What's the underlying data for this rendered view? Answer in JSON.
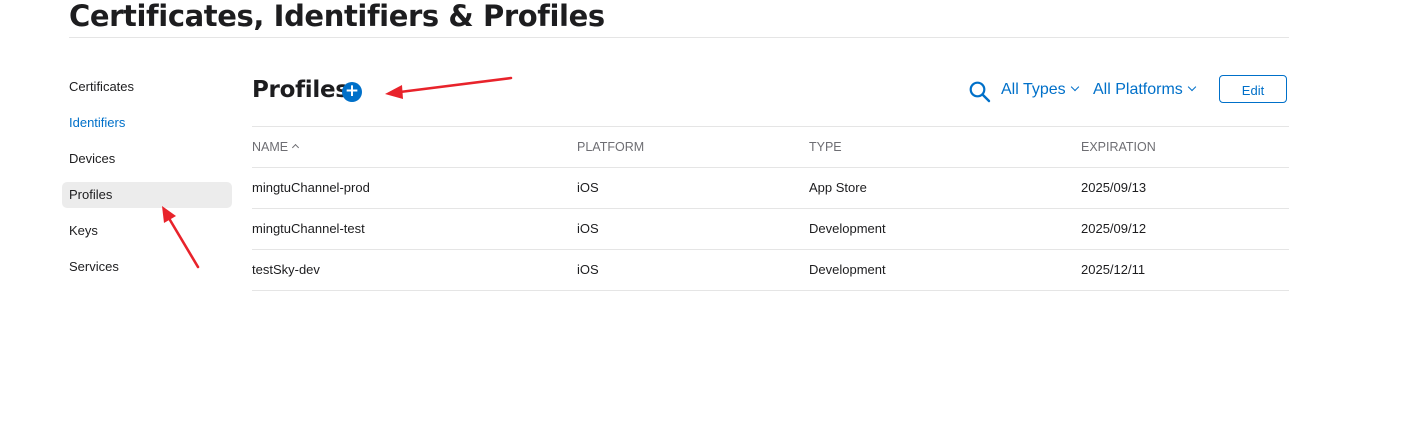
{
  "header": {
    "title": "Certificates, Identifiers & Profiles"
  },
  "sidebar": {
    "items": [
      {
        "label": "Certificates"
      },
      {
        "label": "Identifiers"
      },
      {
        "label": "Devices"
      },
      {
        "label": "Profiles"
      },
      {
        "label": "Keys"
      },
      {
        "label": "Services"
      }
    ]
  },
  "main": {
    "title": "Profiles",
    "add_symbol": "+",
    "filters": {
      "types": "All Types",
      "platforms": "All Platforms"
    },
    "edit_label": "Edit",
    "table": {
      "headers": {
        "name": "NAME",
        "platform": "PLATFORM",
        "type": "TYPE",
        "expiration": "EXPIRATION"
      },
      "rows": [
        {
          "name": "mingtuChannel-prod",
          "platform": "iOS",
          "type": "App Store",
          "expiration": "2025/09/13"
        },
        {
          "name": "mingtuChannel-test",
          "platform": "iOS",
          "type": "Development",
          "expiration": "2025/09/12"
        },
        {
          "name": "testSky-dev",
          "platform": "iOS",
          "type": "Development",
          "expiration": "2025/12/11"
        }
      ]
    }
  },
  "colors": {
    "accent": "#0070c9",
    "annotation": "#e8232b",
    "active_bg": "#ececec",
    "rule": "#e5e5e5"
  },
  "icons": {
    "search": "search-icon",
    "add": "plus-circle-icon",
    "sort": "chevron-up-icon",
    "dropdown": "chevron-down-icon"
  }
}
